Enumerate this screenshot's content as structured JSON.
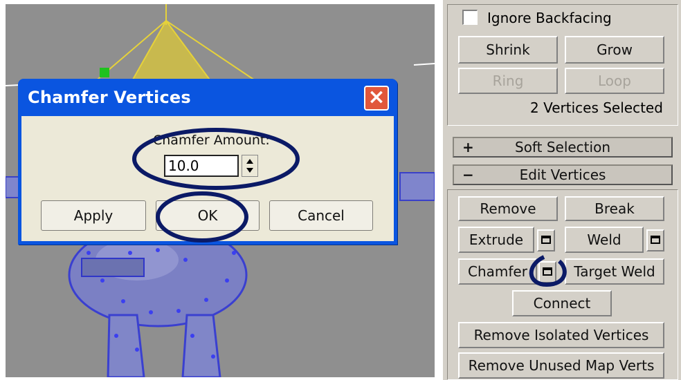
{
  "viewport": {
    "label": "3D viewport"
  },
  "dialog": {
    "title": "Chamfer Vertices",
    "close_icon": "close-icon",
    "amount_label": "Chamfer Amount:",
    "amount_value": "10.0",
    "apply_label": "Apply",
    "ok_label": "OK",
    "cancel_label": "Cancel"
  },
  "panel": {
    "ignore_backfacing_label": "Ignore Backfacing",
    "shrink_label": "Shrink",
    "grow_label": "Grow",
    "ring_label": "Ring",
    "loop_label": "Loop",
    "selection_status": "2 Vertices Selected",
    "soft_selection": {
      "sign": "+",
      "label": "Soft Selection"
    },
    "edit_vertices": {
      "sign": "−",
      "label": "Edit Vertices"
    },
    "remove_label": "Remove",
    "break_label": "Break",
    "extrude_label": "Extrude",
    "weld_label": "Weld",
    "chamfer_label": "Chamfer",
    "target_weld_label": "Target Weld",
    "connect_label": "Connect",
    "remove_isolated_label": "Remove Isolated Vertices",
    "remove_unused_label": "Remove Unused Map Verts"
  },
  "colors": {
    "xp_title_blue": "#0a55e0",
    "panel_gray": "#d4d0c8",
    "annotation_ink": "#0b1a66"
  }
}
